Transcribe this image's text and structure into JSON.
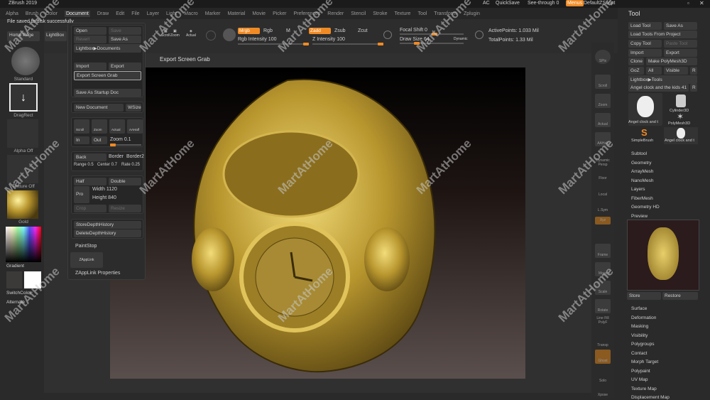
{
  "app": {
    "title": "ZBrush 2019",
    "status_message": "File saved to disk successfully"
  },
  "titlebar": {
    "ac": "AC",
    "quicksave": "QuickSave",
    "see_through": "See-through  0",
    "menus": "Menus",
    "default_script": "DefaultZScript"
  },
  "menubar": [
    "Alpha",
    "Brush",
    "Color",
    "Document",
    "Draw",
    "Edit",
    "File",
    "Layer",
    "Light",
    "Macro",
    "Marker",
    "Material",
    "Movie",
    "Picker",
    "Preferences",
    "Render",
    "Stencil",
    "Stroke",
    "Texture",
    "Tool",
    "Transform",
    "Zplugin"
  ],
  "menubar_active": "Document",
  "toolbar": {
    "home_page": "Home Page",
    "lightbox": "LightBox",
    "scroll": "Scroll",
    "zoom": "Zoom",
    "actual": "Actual",
    "mrgb": "Mrgb",
    "rgb": "Rgb",
    "m": "M",
    "rgb_intensity": "Rgb Intensity 100",
    "zadd": "Zadd",
    "zsub": "Zsub",
    "zcut": "Zcut",
    "z_intensity": "Z Intensity 100",
    "focal_shift": "Focal Shift 0",
    "draw_size": "Draw Size 64",
    "dynamic": "Dynamic",
    "active_points": "ActivePoints: 1.033 Mil",
    "total_points": "TotalPoints: 1.33 Mil"
  },
  "document_menu": {
    "open": "Open",
    "save": "Save",
    "revert": "Revert",
    "save_as": "Save As",
    "lightbox_documents": "Lightbox▶Documents",
    "import": "Import",
    "export": "Export",
    "export_screen_grab": "Export Screen Grab",
    "save_as_startup": "Save As Startup Doc",
    "new_document": "New Document",
    "wsize": "WSize",
    "scroll": "Scroll",
    "zoom": "Zoom",
    "actual": "Actual",
    "aahalf": "AAHalf",
    "in": "In",
    "out": "Out",
    "zoom_value": "Zoom 0.1",
    "back": "Back",
    "border": "Border",
    "border2": "Border2",
    "range": "Range 0.5",
    "center": "Center 0.7",
    "rate": "Rate 0.25",
    "half": "Half",
    "double": "Double",
    "pro": "Pro",
    "width": "Width 1120",
    "height": "Height 840",
    "crop": "Crop",
    "resize": "Resize",
    "store_depth": "StoreDepthHistory",
    "delete_depth": "DeleteDepthHistory",
    "paintstop": "PaintStop",
    "zapplink": "ZAppLink",
    "zapplink_props": "ZAppLink Properties"
  },
  "document_menu_values": {
    "range": 0.5,
    "center": 0.7,
    "rate": 0.25,
    "zoom": 0.1
  },
  "viewport": {
    "title": "Export Screen Grab"
  },
  "left_shelf": {
    "standard": "Standard",
    "dragrect": "DragRect",
    "alpha": "Alpha Off",
    "texture": "Texture Off",
    "material": "Gold",
    "gradient": "Gradient",
    "switch_color": "SwitchColor",
    "alternate": "Alternate"
  },
  "right_shelf": [
    "SPix",
    "Scroll",
    "Zoom",
    "Actual",
    "AAHalf",
    "Dynamic Persp",
    "Floor",
    "Local",
    "L.Sym",
    "Xyz",
    "Frame",
    "Move",
    "Scale",
    "Rotate",
    "Line Fill PolyF",
    "Transp",
    "Ghost",
    "Solo",
    "Xpose"
  ],
  "tool_panel": {
    "title": "Tool",
    "load_tool": "Load Tool",
    "save_as": "Save As",
    "load_from_project": "Load Tools From Project",
    "copy_tool": "Copy Tool",
    "paste_tool": "Paste Tool",
    "import": "Import",
    "export": "Export",
    "clone": "Clone",
    "make_polymesh": "Make PolyMesh3D",
    "goz": "GoZ",
    "all": "All",
    "visible": "Visible",
    "r": "R",
    "lightbox_tools": "Lightbox▶Tools",
    "current_tool": "Angel clock and the kids  41",
    "r2": "R",
    "tools": [
      "Angel clock and t",
      "Cylinder3D",
      "PolyMesh3D",
      "SimpleBrush",
      "Angel clock and t"
    ],
    "sections": [
      "Subtool",
      "Geometry",
      "ArrayMesh",
      "NanoMesh",
      "Layers",
      "FiberMesh",
      "Geometry HD",
      "Preview"
    ],
    "store": "Store",
    "restore": "Restore",
    "sections2": [
      "Surface",
      "Deformation",
      "Masking",
      "Visibility",
      "Polygroups",
      "Contact",
      "Morph Target",
      "Polypaint",
      "UV Map",
      "Texture Map",
      "Displacement Map"
    ]
  },
  "watermark": "MartAtHome",
  "colors": {
    "accent": "#f08a24",
    "gold": "#b8962e"
  }
}
